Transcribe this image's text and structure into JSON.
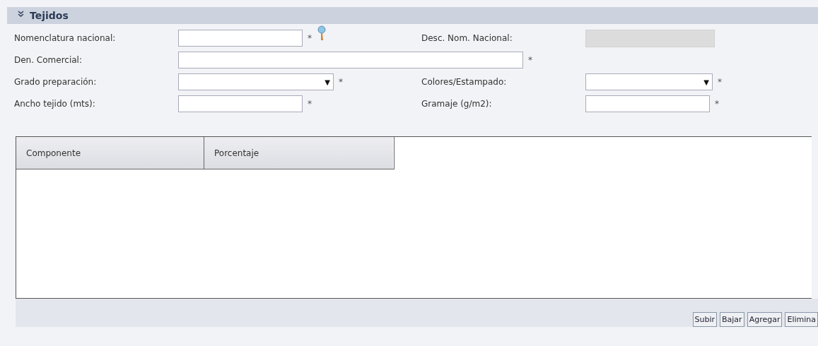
{
  "section": {
    "title": "Tejidos",
    "expanded": true
  },
  "fields": [
    {
      "label": "Nomenclatura nacional:",
      "kind": "text",
      "required": true,
      "lookup": true
    },
    {
      "label": "Desc. Nom. Nacional:",
      "kind": "readonly",
      "required": false,
      "lookup": false
    },
    {
      "label": "Den. Comercial:",
      "kind": "wide_text",
      "required": true,
      "lookup": false
    },
    {
      "label": "Grado preparación:",
      "kind": "select",
      "required": true,
      "lookup": false
    },
    {
      "label": "Colores/Estampado:",
      "kind": "select",
      "required": true,
      "lookup": false
    },
    {
      "label": "Ancho tejido (mts):",
      "kind": "text",
      "required": true,
      "lookup": false
    },
    {
      "label": "Gramaje (g/m2):",
      "kind": "text",
      "required": true,
      "lookup": false
    }
  ],
  "required_mark": "*",
  "select_arrow": "▼",
  "table": {
    "columns": [
      "Componente",
      "Porcentaje"
    ]
  },
  "buttons": [
    "Subir",
    "Bajar",
    "Agregar",
    "Elimina"
  ]
}
